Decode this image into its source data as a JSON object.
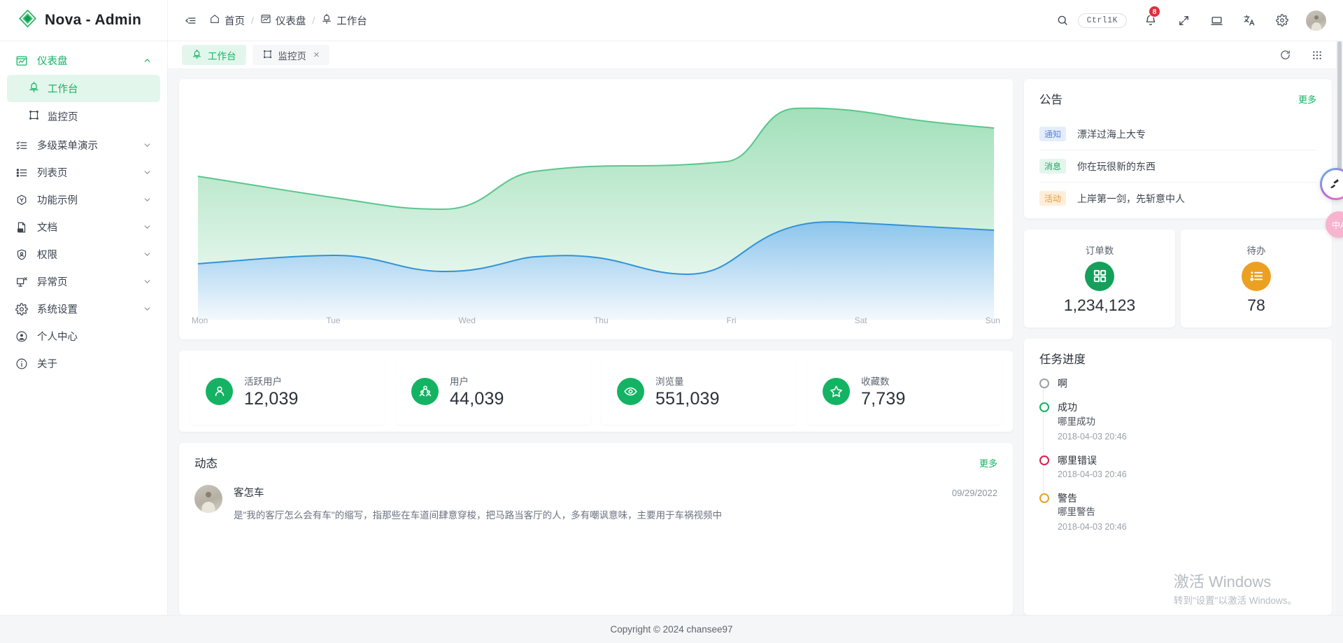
{
  "brand": {
    "title": "Nova - Admin",
    "logo_icon": "nova-diamond-logo"
  },
  "header": {
    "collapse_icon": "collapse-menu-icon",
    "breadcrumb": [
      {
        "icon": "home-icon",
        "label": "首页"
      },
      {
        "icon": "dashboard-icon",
        "label": "仪表盘"
      },
      {
        "icon": "workbench-icon",
        "label": "工作台"
      }
    ],
    "separator": "/",
    "search_icon": "search-icon",
    "shortcut": "Ctrl1K",
    "bell_icon": "bell-icon",
    "bell_badge": "8",
    "fullscreen_icon": "fullscreen-icon",
    "screen_icon": "laptop-screen-icon",
    "translate_icon": "translate-icon",
    "settings_icon": "gear-icon",
    "avatar_name": "user-avatar"
  },
  "sidebar": {
    "groups": [
      {
        "label": "仪表盘",
        "icon": "dashboard-icon",
        "open": true,
        "children": [
          {
            "label": "工作台",
            "icon": "workbench-icon",
            "active": true
          },
          {
            "label": "监控页",
            "icon": "monitor-icon",
            "active": false
          }
        ]
      },
      {
        "label": "多级菜单演示",
        "icon": "checklist-icon",
        "open": false,
        "children": []
      },
      {
        "label": "列表页",
        "icon": "list-icon",
        "open": false,
        "children": []
      },
      {
        "label": "功能示例",
        "icon": "hexagon-icon",
        "open": false,
        "children": []
      },
      {
        "label": "文档",
        "icon": "doc-icon",
        "open": false,
        "children": []
      },
      {
        "label": "权限",
        "icon": "shield-user-icon",
        "open": false,
        "children": []
      },
      {
        "label": "异常页",
        "icon": "monitor-error-icon",
        "open": false,
        "children": []
      },
      {
        "label": "系统设置",
        "icon": "gear-icon",
        "open": false,
        "children": []
      },
      {
        "label": "个人中心",
        "icon": "user-circle-icon",
        "open": false,
        "children": []
      },
      {
        "label": "关于",
        "icon": "info-circle-icon",
        "open": false,
        "children": []
      }
    ]
  },
  "tabs": {
    "items": [
      {
        "label": "工作台",
        "icon": "workbench-icon",
        "active": true,
        "closable": false
      },
      {
        "label": "监控页",
        "icon": "monitor-icon",
        "active": false,
        "closable": true
      }
    ],
    "close_glyph": "×",
    "refresh_icon": "refresh-icon",
    "grid_icon": "grid-apps-icon"
  },
  "chart_data": {
    "type": "area",
    "title": "",
    "xlabel": "",
    "ylabel": "",
    "categories": [
      "Mon",
      "Tue",
      "Wed",
      "Thu",
      "Fri",
      "Sat",
      "Sun"
    ],
    "ylim": [
      0,
      100
    ],
    "grid": false,
    "legend": "none",
    "series": [
      {
        "name": "series-green",
        "color": "#4ac58a",
        "fill_top": "#a8e3c0",
        "fill_bottom": "#f4fbf7",
        "values": [
          62,
          58,
          53,
          74,
          76,
          96,
          90
        ]
      },
      {
        "name": "series-blue",
        "color": "#2f8fd6",
        "fill_top": "#8fc6ec",
        "fill_bottom": "#f2f8fd",
        "values": [
          22,
          24,
          20,
          24,
          19,
          42,
          39
        ]
      }
    ]
  },
  "stats": [
    {
      "label": "活跃用户",
      "value": "12,039",
      "icon": "user-icon",
      "color": "#13b363"
    },
    {
      "label": "用户",
      "value": "44,039",
      "icon": "users-group-icon",
      "color": "#13b363"
    },
    {
      "label": "浏览量",
      "value": "551,039",
      "icon": "eye-icon",
      "color": "#13b363"
    },
    {
      "label": "收藏数",
      "value": "7,739",
      "icon": "star-icon",
      "color": "#13b363"
    }
  ],
  "activity": {
    "title": "动态",
    "more_label": "更多",
    "items": [
      {
        "name": "客怎车",
        "date": "09/29/2022",
        "desc": "是\"我的客厅怎么会有车\"的缩写，指那些在车道间肆意穿梭，把马路当客厅的人，多有嘲讽意味，主要用于车祸视频中"
      }
    ]
  },
  "announcement": {
    "title": "公告",
    "more_label": "更多",
    "items": [
      {
        "tag": "通知",
        "tag_color": "blue",
        "text": "漂洋过海上大专"
      },
      {
        "tag": "消息",
        "tag_color": "green",
        "text": "你在玩很新的东西"
      },
      {
        "tag": "活动",
        "tag_color": "orange",
        "text": "上岸第一剑，先斩意中人"
      }
    ]
  },
  "mini_stats": [
    {
      "label": "订单数",
      "value": "1,234,123",
      "icon": "grid-squares-icon",
      "color": "#13a05b"
    },
    {
      "label": "待办",
      "value": "78",
      "icon": "todo-list-icon",
      "color": "#eca022"
    }
  ],
  "timeline": {
    "title": "任务进度",
    "items": [
      {
        "title": "啊",
        "desc": "",
        "time": "",
        "color": "gray"
      },
      {
        "title": "成功",
        "desc": "哪里成功",
        "time": "2018-04-03 20:46",
        "color": "green"
      },
      {
        "title": "哪里错误",
        "desc": "",
        "time": "2018-04-03 20:46",
        "color": "red"
      },
      {
        "title": "警告",
        "desc": "哪里警告",
        "time": "2018-04-03 20:46",
        "color": "orange"
      }
    ]
  },
  "floating": {
    "ring_icon": "rainbow-ring-icon",
    "lang_label": "中A"
  },
  "watermark": {
    "line1": "激活 Windows",
    "line2": "转到\"设置\"以激活 Windows。"
  },
  "footer": {
    "copyright": "Copyright © 2024 chansee97"
  }
}
